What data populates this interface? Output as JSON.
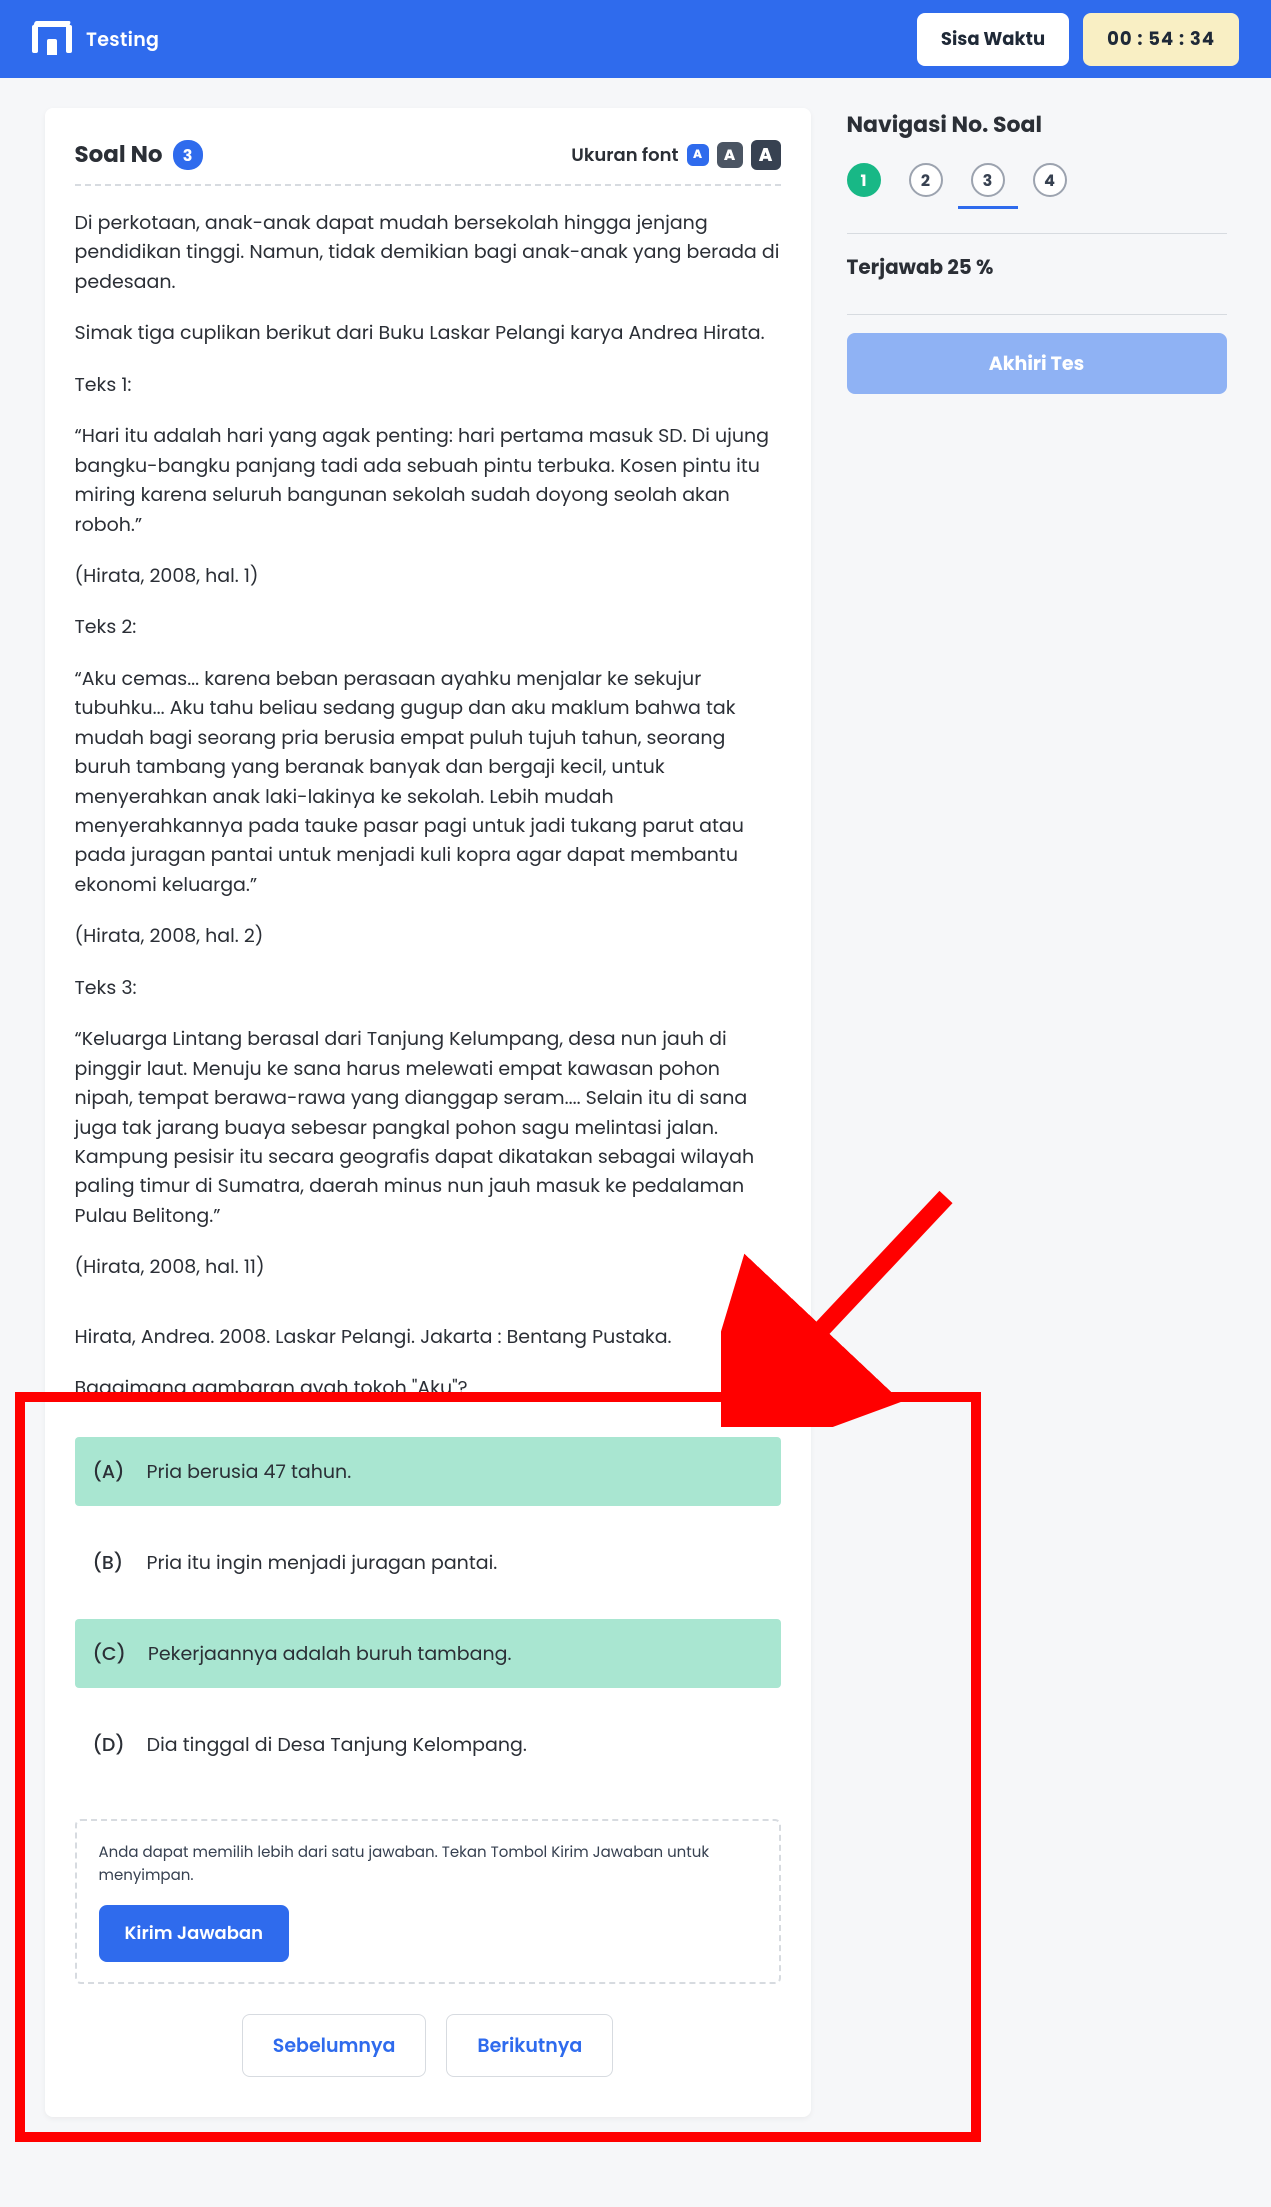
{
  "header": {
    "app_title": "Testing",
    "sisa_label": "Sisa Waktu",
    "timer": "00 : 54 : 34"
  },
  "question": {
    "no_label": "Soal No",
    "number": "3",
    "font_label": "Ukuran font",
    "font_small": "A",
    "font_medium": "A",
    "font_large": "A",
    "p1": "Di perkotaan, anak-anak dapat mudah bersekolah hingga jenjang pendidikan tinggi. Namun, tidak demikian bagi anak-anak yang berada di pedesaan.",
    "p2": "Simak tiga cuplikan berikut dari Buku Laskar Pelangi karya Andrea Hirata.",
    "teks1_label": "Teks 1:",
    "teks1": "“Hari itu adalah hari yang agak penting: hari pertama masuk SD. Di ujung bangku-bangku panjang tadi ada sebuah pintu terbuka. Kosen pintu itu miring karena seluruh bangunan sekolah sudah doyong seolah akan roboh.”",
    "cite1": "(Hirata, 2008, hal. 1)",
    "teks2_label": "Teks 2:",
    "teks2": "“Aku cemas... karena beban perasaan  ayahku menjalar ke sekujur tubuhku... Aku tahu beliau sedang gugup dan aku maklum bahwa tak mudah bagi seorang pria berusia empat puluh tujuh tahun, seorang buruh tambang yang beranak banyak dan bergaji kecil, untuk menyerahkan anak laki-lakinya ke sekolah. Lebih mudah menyerahkannya pada tauke pasar pagi untuk jadi tukang parut atau pada juragan pantai untuk menjadi kuli kopra agar dapat membantu ekonomi keluarga.”",
    "cite2": "(Hirata, 2008, hal. 2)",
    "teks3_label": "Teks 3:",
    "teks3": "“Keluarga Lintang berasal dari Tanjung Kelumpang, desa nun jauh di pinggir laut. Menuju ke sana harus melewati empat kawasan pohon nipah, tempat berawa-rawa yang dianggap seram.... Selain itu di sana juga tak jarang buaya sebesar pangkal pohon sagu melintasi jalan. Kampung pesisir itu secara geografis dapat dikatakan sebagai wilayah paling timur di Sumatra, daerah minus nun jauh masuk ke pedalaman Pulau Belitong.”",
    "cite3": "(Hirata, 2008, hal. 11)",
    "reference": "Hirata, Andrea. 2008. Laskar Pelangi.  Jakarta :  Bentang Pustaka.",
    "prompt": "Bagaimana gambaran ayah tokoh \"Aku\"?"
  },
  "answers": [
    {
      "letter": "(A)",
      "text": "Pria berusia 47 tahun.",
      "selected": true
    },
    {
      "letter": "(B)",
      "text": "Pria itu ingin menjadi juragan pantai.",
      "selected": false
    },
    {
      "letter": "(C)",
      "text": "Pekerjaannya adalah buruh tambang.",
      "selected": true
    },
    {
      "letter": "(D)",
      "text": "Dia tinggal di Desa Tanjung Kelompang.",
      "selected": false
    }
  ],
  "submit": {
    "note": "Anda dapat memilih lebih dari satu jawaban. Tekan Tombol Kirim Jawaban untuk menyimpan.",
    "button": "Kirim Jawaban",
    "prev": "Sebelumnya",
    "next": "Berikutnya"
  },
  "sidebar": {
    "title": "Navigasi No. Soal",
    "items": [
      "1",
      "2",
      "3",
      "4"
    ],
    "progress": "Terjawab 25 %",
    "end": "Akhiri Tes"
  }
}
